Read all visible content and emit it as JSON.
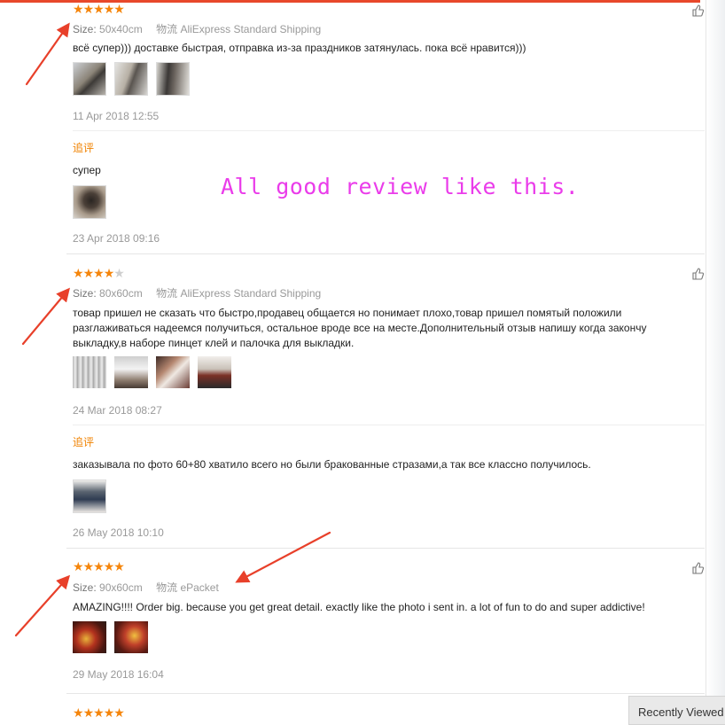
{
  "annotation": "All good review like this.",
  "recently_viewed_label": "Recently Viewed",
  "labels": {
    "size": "Size:",
    "shipping": "物流",
    "additional": "追评"
  },
  "reviews": [
    {
      "rating": 5,
      "size": "50x40cm",
      "shipping": "AliExpress Standard Shipping",
      "text": "всё супер))) доставке быстрая, отправка из-за праздников затянулась. пока всё нравится)))",
      "photo_count": 3,
      "date": "11 Apr 2018 12:55",
      "additional": {
        "text": "супер",
        "photo_count": 1,
        "date": "23 Apr 2018 09:16"
      }
    },
    {
      "rating": 4,
      "size": "80x60cm",
      "shipping": "AliExpress Standard Shipping",
      "text": "товар пришел не сказать что быстро,продавец общается но понимает плохо,товар пришел помятый положили разглаживаться надеемся получиться, остальное вроде все на месте.Дополнительный отзыв напишу когда закончу выкладку,в наборе пинцет клей и палочка для выкладки.",
      "photo_count": 4,
      "date": "24 Mar 2018 08:27",
      "additional": {
        "text": "заказывала по фото 60+80 хватило всего но были бракованные стразами,а так все классно получилось.",
        "photo_count": 1,
        "date": "26 May 2018 10:10"
      }
    },
    {
      "rating": 5,
      "size": "90x60cm",
      "shipping": "ePacket",
      "text": "AMAZING!!!! Order big. because you get great detail. exactly like the photo i sent in. a lot of fun to do and super addictive!",
      "photo_count": 2,
      "date": "29 May 2018 16:04"
    },
    {
      "rating": 5
    }
  ],
  "colors": {
    "star": "#f5850b",
    "star_off": "#cfcfcf",
    "accent_line": "#e8482b",
    "additional_label": "#f08200",
    "annotation": "#ea3cea",
    "arrow": "#e8402a"
  }
}
